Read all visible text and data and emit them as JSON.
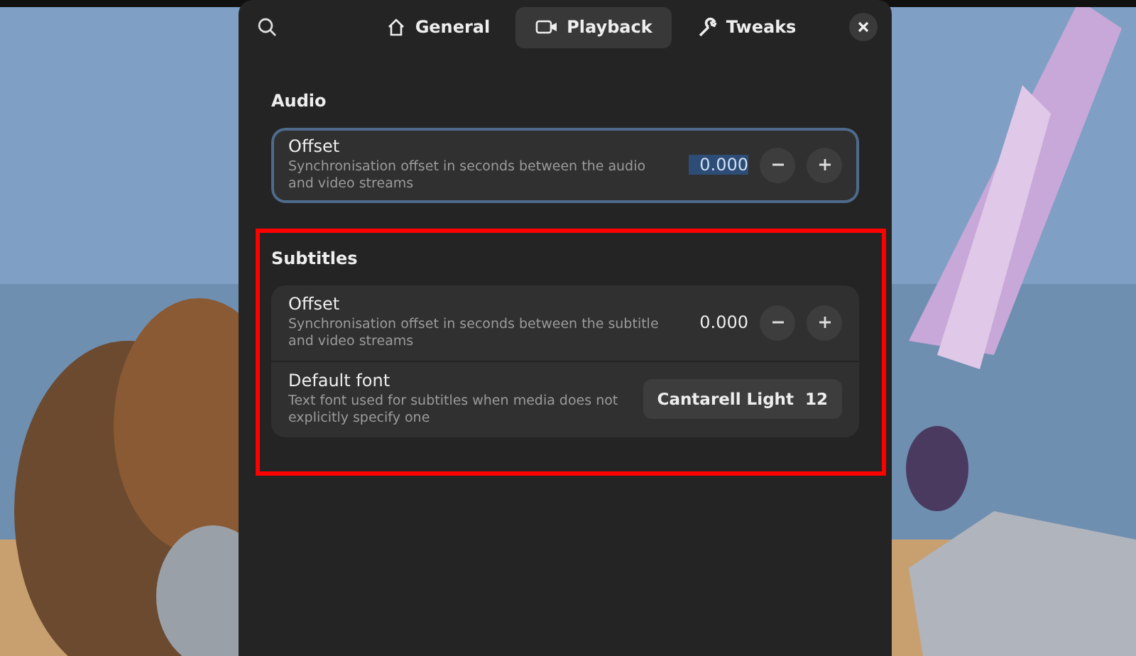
{
  "header": {
    "tabs": [
      {
        "label": "General",
        "selected": false
      },
      {
        "label": "Playback",
        "selected": true
      },
      {
        "label": "Tweaks",
        "selected": false
      }
    ]
  },
  "sections": [
    {
      "title": "Audio",
      "highlighted": false,
      "rows": [
        {
          "kind": "spin",
          "title": "Offset",
          "subtitle": "Synchronisation offset in seconds between the audio and video streams",
          "value": "0.000",
          "focused": true,
          "value_selected": true
        }
      ]
    },
    {
      "title": "Subtitles",
      "highlighted": true,
      "rows": [
        {
          "kind": "spin",
          "title": "Offset",
          "subtitle": "Synchronisation offset in seconds between the subtitle and video streams",
          "value": "0.000",
          "focused": false,
          "value_selected": false
        },
        {
          "kind": "font",
          "title": "Default font",
          "subtitle": "Text font used for subtitles when media does not explicitly specify one",
          "font_name": "Cantarell Light",
          "font_size": "12"
        }
      ]
    }
  ]
}
